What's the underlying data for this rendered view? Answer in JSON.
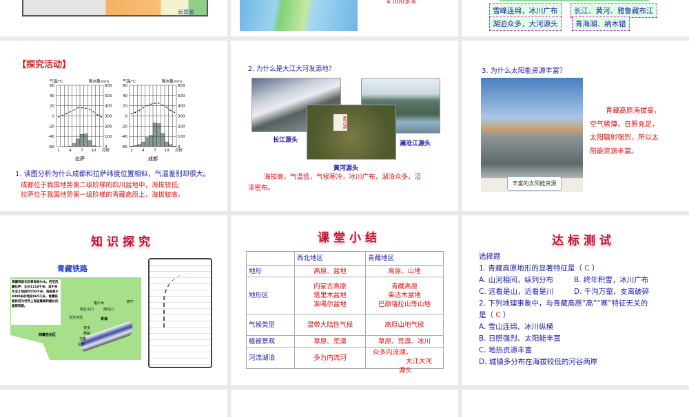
{
  "slides_row0": {
    "s1": {
      "map_label": "云南省"
    },
    "s2": {
      "note": "4 000多米"
    },
    "s3": {
      "tags": [
        "雪峰连绵，冰川广布",
        "长江、黄河、雅鲁藏布江",
        "湖泊众多，大河源头",
        "青海湖、纳木错"
      ]
    }
  },
  "slide_activity": {
    "title": "【探究活动】",
    "question": "1. 读图分析为什么成都和拉萨纬度位置相似，气温差别却很大。",
    "answer": [
      "成都位于我国地势第二级阶梯的四川盆地中，海拔较低;",
      "拉萨位于我国地势第一级阶梯的青藏高原上，海拔较高。"
    ]
  },
  "chart_data": [
    {
      "type": "bar+line",
      "title": "拉萨",
      "ylabel_left": "气温/℃",
      "ylabel_right": "降水量/mm",
      "xlabel": "月份",
      "x_ticks": [
        "1",
        "4",
        "7",
        "10"
      ],
      "left_ticks": [
        "60",
        "40",
        "20",
        "0",
        "-20",
        "-40",
        "-60"
      ],
      "right_ticks": [
        "600",
        "500",
        "400",
        "300",
        "200",
        "100",
        "0"
      ],
      "ylim_temp": [
        -60,
        60
      ],
      "ylim_precip": [
        0,
        600
      ],
      "months": [
        1,
        2,
        3,
        4,
        5,
        6,
        7,
        8,
        9,
        10,
        11,
        12
      ],
      "temperature": [
        -2,
        1,
        5,
        8,
        12,
        16,
        16,
        15,
        13,
        8,
        2,
        -2
      ],
      "precipitation": [
        0,
        1,
        2,
        5,
        30,
        75,
        120,
        125,
        60,
        8,
        1,
        0
      ]
    },
    {
      "type": "bar+line",
      "title": "成都",
      "ylabel_left": "气温/℃",
      "ylabel_right": "降水量/mm",
      "xlabel": "月份",
      "x_ticks": [
        "1",
        "4",
        "7",
        "10"
      ],
      "left_ticks": [
        "60",
        "40",
        "20",
        "0",
        "-20",
        "-40",
        "-60"
      ],
      "right_ticks": [
        "600",
        "500",
        "400",
        "300",
        "200",
        "100",
        "0"
      ],
      "ylim_temp": [
        -60,
        60
      ],
      "ylim_precip": [
        0,
        600
      ],
      "months": [
        1,
        2,
        3,
        4,
        5,
        6,
        7,
        8,
        9,
        10,
        11,
        12
      ],
      "temperature": [
        5,
        7,
        11,
        16,
        20,
        23,
        25,
        25,
        21,
        17,
        11,
        7
      ],
      "precipitation": [
        5,
        10,
        20,
        45,
        90,
        110,
        230,
        225,
        130,
        45,
        20,
        5
      ]
    }
  ],
  "slide_rivers": {
    "question": "2. 为什么是大江大河发源地？",
    "labels": {
      "yangtze": "长江源头",
      "lancang": "澜沧江源头",
      "yellow": "黄河源头"
    },
    "sign_text": "黄河源",
    "answer": [
      "海拔高，气温低，气候寒冷，冰川广布，湖泊众多，沼",
      "泽密布。"
    ]
  },
  "slide_solar": {
    "question": "3. 为什么太阳能资源丰富？",
    "caption": "丰富的太阳能资源",
    "answer": [
      "青藏高原海拔高，",
      "空气稀薄，日照充足，",
      "太阳辐射强烈，所以太",
      "阳能资源丰富。"
    ]
  },
  "slide_railway": {
    "title": "知识探究",
    "subtitle": "青藏铁路",
    "desc": "青藏铁路东起青海格尔木，西至西藏拉萨，全长1118千米，其中多年冻土地段约550千米，海拔高于4000米的地段965千米，青藏铁路将成为世界上海拔最高和最长的高原铁路。",
    "places": [
      "格尔木",
      "昆仑山口",
      "沱沱河沿",
      "安多",
      "那曲",
      "当雄",
      "拉萨",
      "西宁",
      "南山口",
      "青海",
      "西藏自治区"
    ]
  },
  "slide_summary": {
    "title": "课堂小结",
    "headers": [
      "",
      "西北地区",
      "青藏地区"
    ],
    "rows": [
      {
        "label": "地形",
        "nw": [
          "高原、盆地"
        ],
        "qz": [
          "高原、山地"
        ]
      },
      {
        "label": "地形区",
        "nw": [
          "内蒙古高原",
          "塔里木盆地",
          "准噶尔盆地"
        ],
        "qz": [
          "青藏高原",
          "柴达木盆地",
          "巴颜喀拉山等山地"
        ]
      },
      {
        "label": "气候类型",
        "nw": [
          "温带大陆性气候"
        ],
        "qz": [
          "高原山地气候"
        ]
      },
      {
        "label": "植被景观",
        "nw": [
          "草原、荒漠"
        ],
        "qz": [
          "草原、荒漠、冰川"
        ]
      },
      {
        "label": "河流湖泊",
        "nw": [
          "多为内流河"
        ],
        "qz": [
          "众多内流湖，",
          "大江大河",
          "源头"
        ]
      }
    ]
  },
  "slide_test": {
    "title": "达标测试",
    "section": "选择题",
    "q1": "1. 青藏高原地形的显著特征是（",
    "q1_answer": "C",
    "q1_close": "）",
    "q1_options": [
      "A. 山河相间，纵列分布",
      "B. 终年积雪，冰川广布",
      "C. 远看是山，近看是川",
      "D. 千沟万壑，支离破碎"
    ],
    "q2": "2. 下列地理事象中，与青藏高原“高”“寒”特征无关的",
    "q2_line2": "是（",
    "q2_answer": "C",
    "q2_close": "）",
    "q2_options": [
      "A. 雪山连绵、冰川纵横",
      "B. 日照强烈、太阳能丰富",
      "C. 地热资源丰富",
      "D. 城镇多分布在海拔较低的河谷两岸"
    ]
  },
  "colors": {
    "background": "#e9e9e9",
    "question_blue": "#1c1ca8",
    "answer_red": "#e01010",
    "title_red": "#c8102e"
  }
}
